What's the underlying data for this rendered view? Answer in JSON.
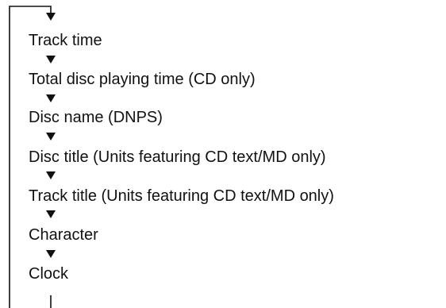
{
  "diagram": {
    "steps": [
      "Track time",
      "Total disc playing time (CD only)",
      "Disc name (DNPS)",
      "Disc title (Units featuring CD text/MD only)",
      "Track title (Units featuring CD text/MD only)",
      "Character",
      "Clock"
    ]
  }
}
